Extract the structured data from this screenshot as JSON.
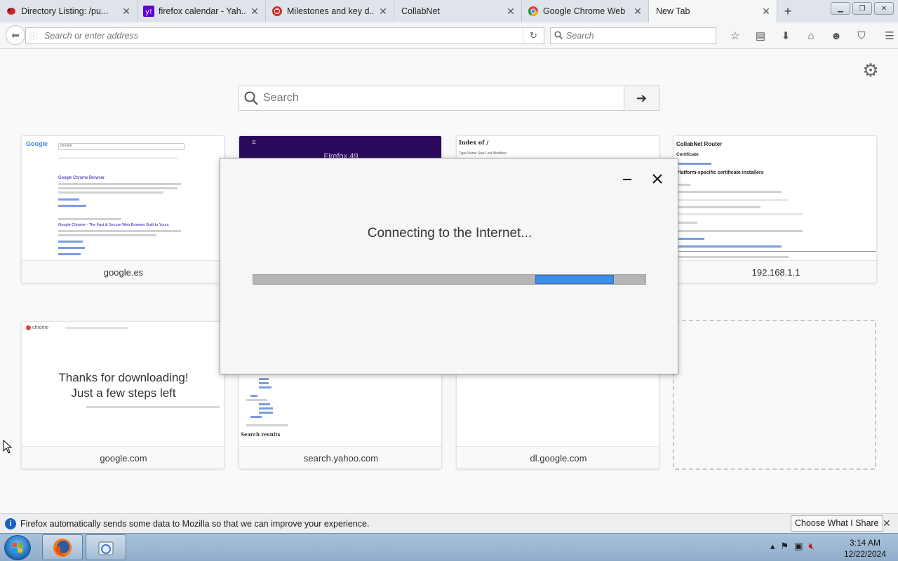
{
  "tabs": [
    {
      "title": "Directory Listing: /pu...",
      "icon": "red-bug-icon"
    },
    {
      "title": "firefox calendar - Yah...",
      "icon": "yahoo-icon"
    },
    {
      "title": "Milestones and key d...",
      "icon": "red-circle-icon"
    },
    {
      "title": "CollabNet",
      "icon": "none"
    },
    {
      "title": "Google Chrome Web ...",
      "icon": "chrome-icon"
    },
    {
      "title": "New Tab",
      "icon": "none"
    }
  ],
  "address_bar": {
    "placeholder": "Search or enter address"
  },
  "search_bar": {
    "placeholder": "Search"
  },
  "newtab_search": {
    "placeholder": "Search"
  },
  "tiles": [
    {
      "caption": "google.es"
    },
    {
      "caption": ""
    },
    {
      "caption": ""
    },
    {
      "caption": "192.168.1.1"
    },
    {
      "caption": "google.com"
    },
    {
      "caption": "search.yahoo.com"
    },
    {
      "caption": "dl.google.com"
    }
  ],
  "tile_thumbs": {
    "firefox49_text": "Firefox 49",
    "index_title": "Index of /",
    "index_cols": "Type   Name   Size   Last Modified",
    "collabnet_title": "CollabNet Router",
    "collabnet_cert": "Certificate",
    "collabnet_heading": "Platform-specific certificate installers",
    "chrome_brand": "chrome",
    "chrome_thanks_line1": "Thanks for downloading!",
    "chrome_thanks_line2": "Just a few steps left",
    "yahoo_results": "Search results",
    "google_es_query": "chrome",
    "google_es_result1": "Google Chrome Browser",
    "google_es_result2": "Google Chrome - The Fast & Secure Web Browser Built to Yours"
  },
  "dialog": {
    "message": "Connecting to the Internet...",
    "progress_start": 0.72,
    "progress_end": 0.92
  },
  "notification": {
    "text": "Firefox automatically sends some data to Mozilla so that we can improve your experience.",
    "button": "Choose What I Share"
  },
  "taskbar": {
    "time": "3:14 AM",
    "date": "12/22/2024"
  },
  "colors": {
    "progress_fill": "#3c8ee6",
    "firefox49_bg": "#2b0a5c",
    "info_blue": "#1a5fc7"
  }
}
